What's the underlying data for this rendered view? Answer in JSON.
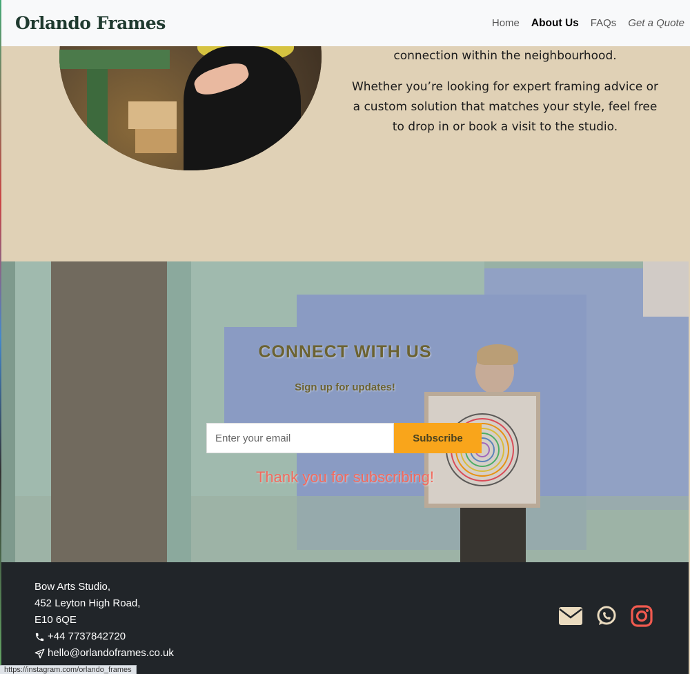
{
  "header": {
    "brand": "Orlando Frames",
    "nav": {
      "home": "Home",
      "about": "About Us",
      "faqs": "FAQs",
      "quote": "Get a Quote"
    }
  },
  "about": {
    "paragraph_1": "connection within the neighbourhood.",
    "paragraph_2": "Whether you’re looking for expert framing advice or a custom solution that matches your style, feel free to drop in or book a visit to the studio."
  },
  "connect": {
    "title": "CONNECT WITH US",
    "subtitle": "Sign up for updates!",
    "email_placeholder": "Enter your email",
    "subscribe_label": "Subscribe",
    "success_message": "Thank you for subscribing!"
  },
  "footer": {
    "address_line_1": "Bow Arts Studio,",
    "address_line_2": "452 Leyton High Road,",
    "address_line_3": "E10 6QE",
    "phone": "+44 7737842720",
    "email": "hello@orlandoframes.co.uk",
    "social_icons": [
      "envelope-icon",
      "whatsapp-icon",
      "instagram-icon"
    ],
    "instagram_color": "#f15a4f",
    "icon_color": "#eadbbf"
  },
  "status_bar": {
    "url": "https://instagram.com/orlando_frames"
  },
  "colors": {
    "accent": "#f9a51b",
    "heading": "#6b6231",
    "success": "#f26a5e",
    "beige": "#e0d1b6",
    "footer_bg": "#212529"
  }
}
